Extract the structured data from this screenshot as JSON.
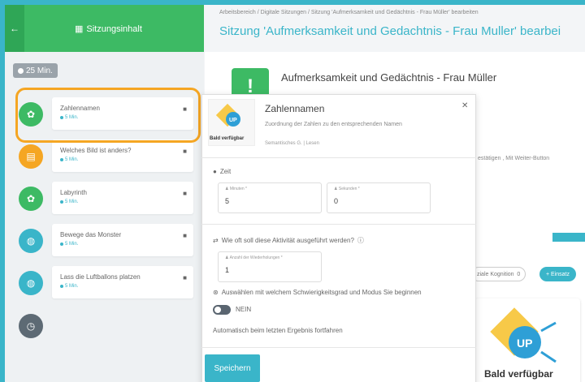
{
  "sidebar": {
    "back_icon": "arrow-left-icon",
    "title": "Sitzungsinhalt",
    "total_time": "25 Min.",
    "activities": [
      {
        "name": "Zahlennamen",
        "duration": "5 Min.",
        "color": "#3dba64",
        "icon": "puzzle-icon"
      },
      {
        "name": "Welches Bild ist anders?",
        "duration": "5 Min.",
        "color": "#f5a623",
        "icon": "calendar-icon"
      },
      {
        "name": "Labyrinth",
        "duration": "5 Min.",
        "color": "#3dba64",
        "icon": "puzzle-icon"
      },
      {
        "name": "Bewege das Monster",
        "duration": "5 Min.",
        "color": "#3ab5c9",
        "icon": "gamepad-icon"
      },
      {
        "name": "Lass die Luftballons platzen",
        "duration": "5 Min.",
        "color": "#3ab5c9",
        "icon": "gamepad-icon"
      }
    ]
  },
  "header": {
    "breadcrumb": "Arbeitsbereich / Digitale Sitzungen / Sitzung 'Aufmerksamkeit und Gedächtnis - Frau Müller' bearbeiten",
    "title": "Sitzung 'Aufmerksamkeit und Gedachtnis - Frau Muller' bearbei"
  },
  "main": {
    "heading": "Aufmerksamkeit und Gedächtnis - Frau Müller",
    "side_text": "estätigen , Mit Weiter-Button",
    "chip_label": "ziale Kognition",
    "chip_count": "0",
    "add_label": "+ Einsatz",
    "card_label": "Bald verfügbar"
  },
  "popover": {
    "logo_label": "Bald verfügbar",
    "title": "Zahlennamen",
    "description": "Zuordnung der Zahlen zu den entsprechenden Namen",
    "meta": "Semantisches G. | Lesen",
    "time_label": "Zeit",
    "minutes_label": "Minuten *",
    "minutes_value": "5",
    "seconds_label": "Sekunden *",
    "seconds_value": "0",
    "repeat_question": "Wie oft soll diese Aktivität ausgeführt werden?",
    "repeat_field_label": "Anzahl der Wiederholungen *",
    "repeat_value": "1",
    "difficulty_label": "Auswählen mit welchem Schwierigkeitsgrad und Modus Sie beginnen",
    "toggle_label": "NEIN",
    "auto_label": "Automatisch beim letzten Ergebnis fortfahren",
    "save_label": "Speichern"
  },
  "colors": {
    "accent": "#3ab5c9",
    "green": "#3dba64",
    "orange": "#f5a623"
  }
}
